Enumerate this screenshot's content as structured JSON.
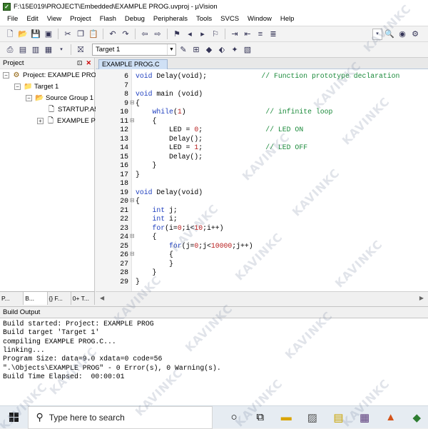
{
  "window": {
    "title": "F:\\15E019\\PROJECT\\Embedded\\EXAMPLE PROG.uvproj - µVision"
  },
  "menu": [
    "File",
    "Edit",
    "View",
    "Project",
    "Flash",
    "Debug",
    "Peripherals",
    "Tools",
    "SVCS",
    "Window",
    "Help"
  ],
  "toolbar": {
    "target": "Target 1"
  },
  "project_panel": {
    "title": "Project",
    "tree": {
      "project": "Project: EXAMPLE PRO",
      "target": "Target 1",
      "group": "Source Group 1",
      "files": [
        "STARTUP.A5",
        "EXAMPLE P"
      ]
    },
    "tabs": [
      "P...",
      "B...",
      "{} F...",
      "0+ T..."
    ]
  },
  "editor": {
    "tab": "EXAMPLE PROG.C",
    "lines": [
      {
        "n": "6",
        "fold": "",
        "parts": [
          {
            "t": "void",
            "c": "kw"
          },
          {
            "t": " Delay(void);             ",
            "c": ""
          },
          {
            "t": "// Function prototype declaration",
            "c": "cm"
          }
        ]
      },
      {
        "n": "7",
        "fold": "",
        "parts": []
      },
      {
        "n": "8",
        "fold": "",
        "parts": [
          {
            "t": "void",
            "c": "kw"
          },
          {
            "t": " main (void)",
            "c": ""
          }
        ]
      },
      {
        "n": "9",
        "fold": "⊟",
        "parts": [
          {
            "t": "{",
            "c": ""
          }
        ]
      },
      {
        "n": "10",
        "fold": "",
        "parts": [
          {
            "t": "    ",
            "c": ""
          },
          {
            "t": "while",
            "c": "kw"
          },
          {
            "t": "(",
            "c": ""
          },
          {
            "t": "1",
            "c": "num"
          },
          {
            "t": ")                   ",
            "c": ""
          },
          {
            "t": "// infinite loop",
            "c": "cm"
          }
        ]
      },
      {
        "n": "11",
        "fold": "⊟",
        "parts": [
          {
            "t": "    {",
            "c": ""
          }
        ]
      },
      {
        "n": "12",
        "fold": "",
        "parts": [
          {
            "t": "        LED = ",
            "c": ""
          },
          {
            "t": "0",
            "c": "num"
          },
          {
            "t": ";               ",
            "c": ""
          },
          {
            "t": "// LED ON",
            "c": "cm"
          }
        ]
      },
      {
        "n": "13",
        "fold": "",
        "parts": [
          {
            "t": "        Delay();",
            "c": ""
          }
        ]
      },
      {
        "n": "14",
        "fold": "",
        "parts": [
          {
            "t": "        LED = ",
            "c": ""
          },
          {
            "t": "1",
            "c": "num"
          },
          {
            "t": ";               ",
            "c": ""
          },
          {
            "t": "// LED OFF",
            "c": "cm"
          }
        ]
      },
      {
        "n": "15",
        "fold": "",
        "parts": [
          {
            "t": "        Delay();",
            "c": ""
          }
        ]
      },
      {
        "n": "16",
        "fold": "",
        "parts": [
          {
            "t": "    }",
            "c": ""
          }
        ]
      },
      {
        "n": "17",
        "fold": "",
        "parts": [
          {
            "t": "}",
            "c": ""
          }
        ]
      },
      {
        "n": "18",
        "fold": "",
        "parts": []
      },
      {
        "n": "19",
        "fold": "",
        "parts": [
          {
            "t": "void",
            "c": "kw"
          },
          {
            "t": " Delay(void)",
            "c": ""
          }
        ]
      },
      {
        "n": "20",
        "fold": "⊟",
        "parts": [
          {
            "t": "{",
            "c": ""
          }
        ]
      },
      {
        "n": "21",
        "fold": "",
        "parts": [
          {
            "t": "    ",
            "c": ""
          },
          {
            "t": "int",
            "c": "kw"
          },
          {
            "t": " j;",
            "c": ""
          }
        ]
      },
      {
        "n": "22",
        "fold": "",
        "parts": [
          {
            "t": "    ",
            "c": ""
          },
          {
            "t": "int",
            "c": "kw"
          },
          {
            "t": " i;",
            "c": ""
          }
        ]
      },
      {
        "n": "23",
        "fold": "",
        "parts": [
          {
            "t": "    ",
            "c": ""
          },
          {
            "t": "for",
            "c": "kw"
          },
          {
            "t": "(i=",
            "c": ""
          },
          {
            "t": "0",
            "c": "num"
          },
          {
            "t": ";i<",
            "c": ""
          },
          {
            "t": "10",
            "c": "num"
          },
          {
            "t": ";i++)",
            "c": ""
          }
        ]
      },
      {
        "n": "24",
        "fold": "⊟",
        "parts": [
          {
            "t": "    {",
            "c": ""
          }
        ]
      },
      {
        "n": "25",
        "fold": "",
        "parts": [
          {
            "t": "        ",
            "c": ""
          },
          {
            "t": "for",
            "c": "kw"
          },
          {
            "t": "(j=",
            "c": ""
          },
          {
            "t": "0",
            "c": "num"
          },
          {
            "t": ";j<",
            "c": ""
          },
          {
            "t": "10000",
            "c": "num"
          },
          {
            "t": ";j++)",
            "c": ""
          }
        ]
      },
      {
        "n": "26",
        "fold": "⊟",
        "parts": [
          {
            "t": "        {",
            "c": ""
          }
        ]
      },
      {
        "n": "27",
        "fold": "",
        "parts": [
          {
            "t": "        }",
            "c": ""
          }
        ]
      },
      {
        "n": "28",
        "fold": "",
        "parts": [
          {
            "t": "    }",
            "c": ""
          }
        ]
      },
      {
        "n": "29",
        "fold": "",
        "parts": [
          {
            "t": "}",
            "c": ""
          }
        ]
      }
    ]
  },
  "build_output": {
    "title": "Build Output",
    "lines": [
      "Build started: Project: EXAMPLE PROG",
      "Build target 'Target 1'",
      "compiling EXAMPLE PROG.C...",
      "linking...",
      "Program Size: data=9.0 xdata=0 code=56",
      "\".\\Objects\\EXAMPLE PROG\" - 0 Error(s), 0 Warning(s).",
      "Build Time Elapsed:  00:00:01"
    ]
  },
  "taskbar": {
    "search_placeholder": "Type here to search"
  },
  "watermark": "KAVINKC"
}
